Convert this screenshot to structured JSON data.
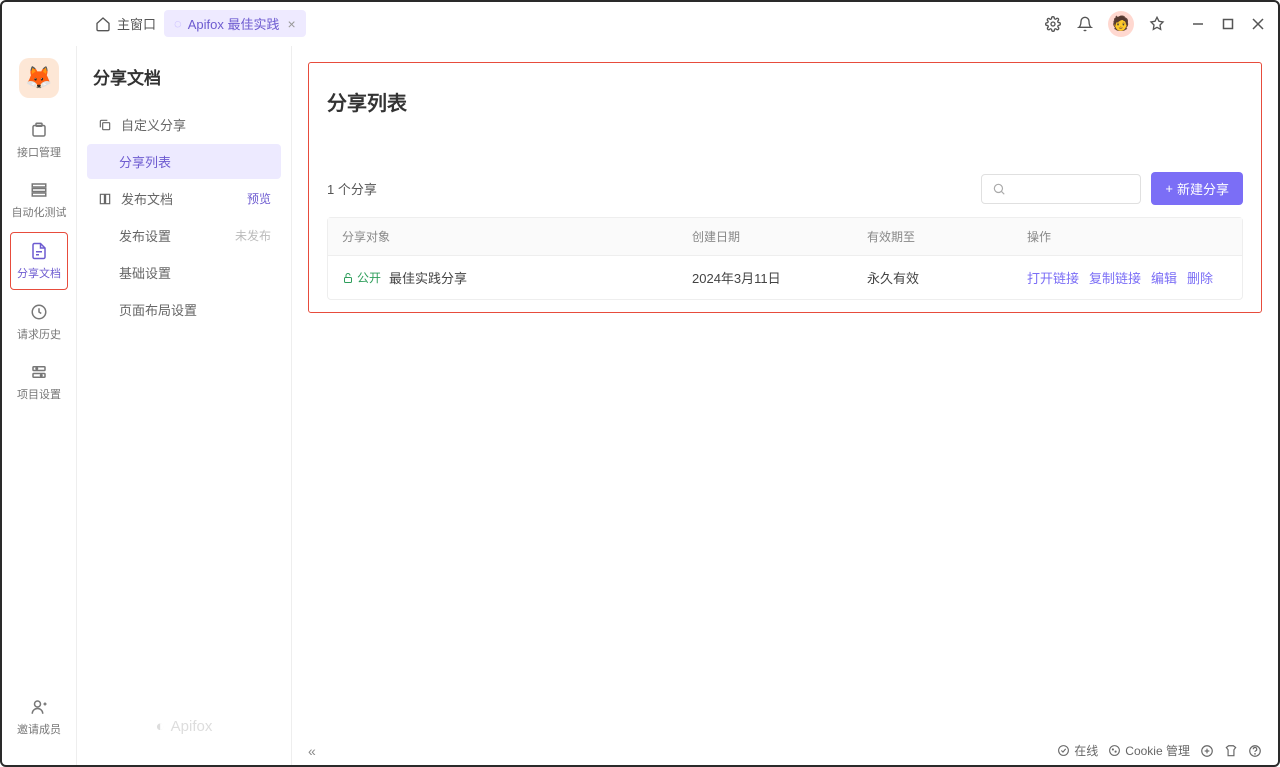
{
  "topbar": {
    "home": "主窗口",
    "tab_label": "Apifox 最佳实践"
  },
  "rail": {
    "items": [
      {
        "label": "接口管理"
      },
      {
        "label": "自动化测试"
      },
      {
        "label": "分享文档"
      },
      {
        "label": "请求历史"
      },
      {
        "label": "项目设置"
      }
    ],
    "invite": "邀请成员"
  },
  "sidebar": {
    "title": "分享文档",
    "custom_share": "自定义分享",
    "share_list": "分享列表",
    "publish_doc": "发布文档",
    "preview": "预览",
    "publish_settings": "发布设置",
    "unpublished": "未发布",
    "basic_settings": "基础设置",
    "layout_settings": "页面布局设置",
    "brand": "Apifox"
  },
  "main": {
    "title": "分享列表",
    "count": "1 个分享",
    "new_share": "新建分享",
    "headers": {
      "object": "分享对象",
      "created": "创建日期",
      "expires": "有效期至",
      "actions": "操作"
    },
    "rows": [
      {
        "visibility": "公开",
        "name": "最佳实践分享",
        "created": "2024年3月11日",
        "expires": "永久有效",
        "actions": {
          "open": "打开链接",
          "copy": "复制链接",
          "edit": "编辑",
          "delete": "删除"
        }
      }
    ]
  },
  "statusbar": {
    "online": "在线",
    "cookie": "Cookie 管理"
  }
}
